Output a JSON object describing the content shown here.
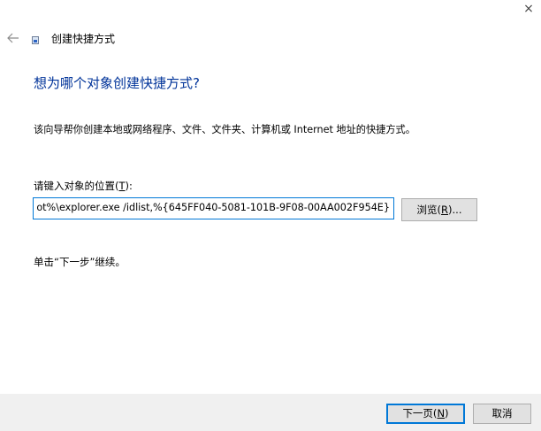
{
  "window": {
    "title": "创建快捷方式",
    "close_glyph": "×"
  },
  "icons": {
    "back": "left-arrow-icon",
    "close": "close-icon",
    "title": "shortcut-icon"
  },
  "main": {
    "heading": "想为哪个对象创建快捷方式?",
    "description": "该向导帮你创建本地或网络程序、文件、文件夹、计算机或 Internet 地址的快捷方式。",
    "location_label_before": "请键入对象的位置(",
    "location_label_key": "T",
    "location_label_after": "):",
    "location_value": "ot%\\explorer.exe /idlist,%{645FF040-5081-101B-9F08-00AA002F954E}",
    "browse_before": "浏览(",
    "browse_key": "R",
    "browse_after": ")...",
    "hint": "单击“下一步”继续。"
  },
  "footer": {
    "next_before": "下一页(",
    "next_key": "N",
    "next_after": ")",
    "cancel_label": "取消"
  },
  "colors": {
    "heading": "#003399",
    "accent": "#0078d7",
    "footer_bg": "#f0f0f0",
    "button_bg": "#e1e1e1"
  }
}
